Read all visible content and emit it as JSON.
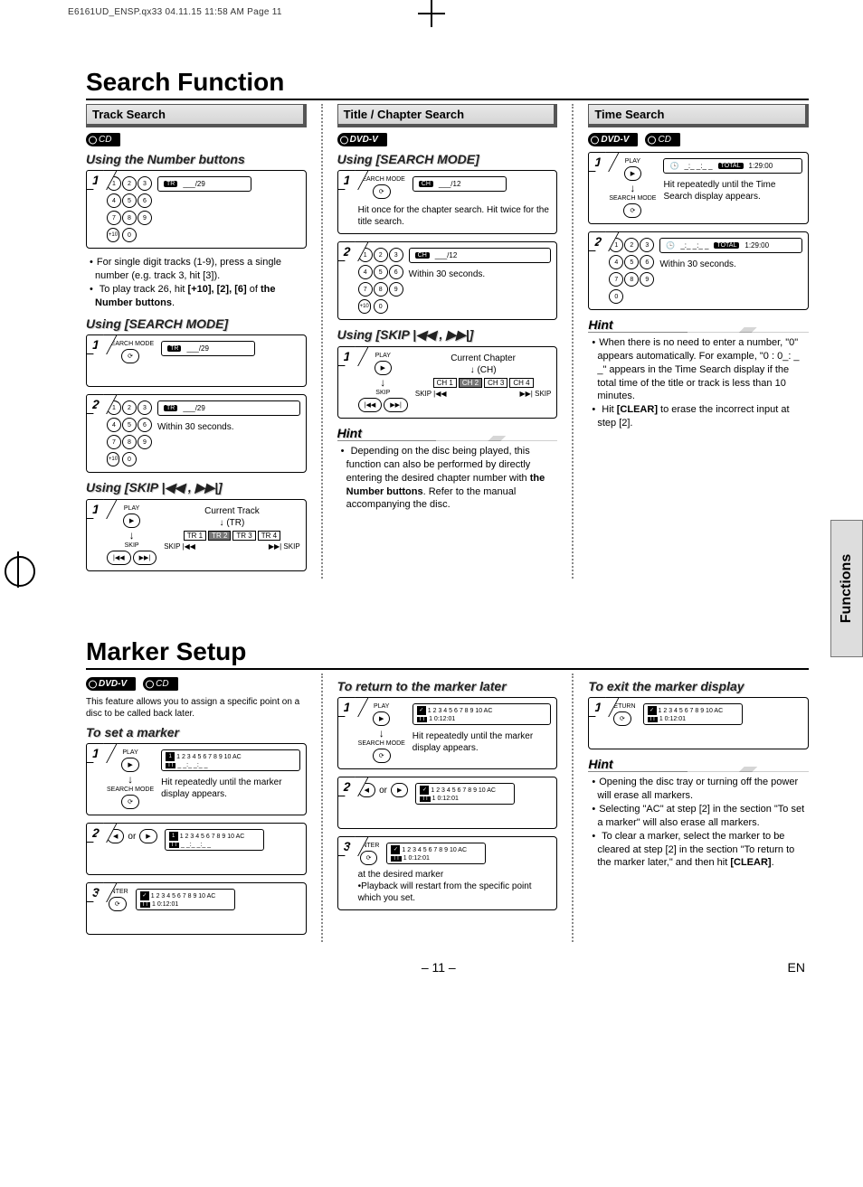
{
  "slug": "E6161UD_ENSP.qx33  04.11.15 11:58 AM  Page 11",
  "footer": {
    "page": "– 11 –",
    "lang": "EN"
  },
  "side_tab": "Functions",
  "section1": {
    "title": "Search Function",
    "col1": {
      "head": "Track Search",
      "badge_cd": "CD",
      "sub1": "Using the Number buttons",
      "display_tr29": "___/29",
      "display_tag_tr": "TR",
      "bul1": "For single digit tracks (1-9), press a single number (e.g. track 3, hit [3]).",
      "bul2_a": "To play track 26, hit ",
      "bul2_b": "[+10], [2], [6]",
      "bul2_c": " of ",
      "bul2_d": "the Number buttons",
      "bul2_e": ".",
      "sub2": "Using [SEARCH MODE]",
      "label_searchmode": "SEARCH MODE",
      "within30": "Within 30 seconds.",
      "sub3": "Using [SKIP |◀◀ , ▶▶|]",
      "label_play": "PLAY",
      "label_skip": "SKIP",
      "cur_track_label": "Current Track",
      "cur_track_abbr": "(TR)",
      "tracks": [
        "TR 1",
        "TR 2",
        "TR 3",
        "TR 4"
      ],
      "skip_prev": "SKIP |◀◀",
      "skip_next": "▶▶| SKIP"
    },
    "col2": {
      "head": "Title / Chapter Search",
      "badge_dvd": "DVD-V",
      "sub1": "Using [SEARCH MODE]",
      "display_tag_ch": "CH",
      "display_ch12": "___/12",
      "step1_note": "Hit once for the chapter search. Hit twice for the title search.",
      "within30": "Within 30 seconds.",
      "sub2": "Using [SKIP |◀◀ , ▶▶|]",
      "label_play": "PLAY",
      "label_skip": "SKIP",
      "cur_ch_label": "Current Chapter",
      "cur_ch_abbr": "(CH)",
      "chapters": [
        "CH 1",
        "CH 2",
        "CH 3",
        "CH 4"
      ],
      "skip_prev": "SKIP |◀◀",
      "skip_next": "▶▶| SKIP",
      "hint_head": "Hint",
      "hint_a": "Depending on the disc being played, this function can also be performed by directly entering the desired chapter number with ",
      "hint_b": "the Number buttons",
      "hint_c": ". Refer to the manual accompanying the disc."
    },
    "col3": {
      "head": "Time Search",
      "badge_dvd": "DVD-V",
      "badge_cd": "CD",
      "label_play": "PLAY",
      "label_searchmode": "SEARCH MODE",
      "total_label": "TOTAL",
      "total_time": "1:29:00",
      "time_blank": "_:_ _:_ _",
      "step1_note": "Hit repeatedly until the Time Search display appears.",
      "within30": "Within 30 seconds.",
      "hint_head": "Hint",
      "hint1": "When there is no need to enter a number, \"0\" appears automatically. For example, \"0 : 0_: _ _\" appears in the Time Search display if the total time of the title or track is less than 10 minutes.",
      "hint2_a": "Hit ",
      "hint2_b": "[CLEAR]",
      "hint2_c": " to erase the incorrect input at step [2]."
    }
  },
  "section2": {
    "title": "Marker Setup",
    "intro_badges": {
      "dvd": "DVD-V",
      "cd": "CD"
    },
    "intro_text": "This feature allows you to assign a specific point on a disc to be called back later.",
    "colA": {
      "sub": "To set a marker",
      "label_play": "PLAY",
      "label_searchmode": "SEARCH MODE",
      "step1_note": "Hit repeatedly until the marker display appears.",
      "or": "or",
      "label_enter": "ENTER",
      "marker_slots": "1 2 3 4 5 6 7 8 9 10 AC",
      "marker_tt": "TT",
      "marker_blank": "_ _:_ _:_ _",
      "marker_time": "1  0:12:01",
      "check": "✓"
    },
    "colB": {
      "sub": "To return to the marker later",
      "label_play": "PLAY",
      "label_searchmode": "SEARCH MODE",
      "step1_note": "Hit repeatedly until the marker display appears.",
      "or": "or",
      "label_enter": "ENTER",
      "step3_note": "at the desired marker",
      "step3_sub": "•Playback will restart from the specific point which you set."
    },
    "colC": {
      "sub": "To exit the marker display",
      "label_return": "RETURN",
      "hint_head": "Hint",
      "hint1": "Opening the disc tray or turning off the power will erase all markers.",
      "hint2": "Selecting \"AC\" at step [2] in the section \"To set a marker\" will also erase all markers.",
      "hint3_a": "To clear a marker, select the marker to be cleared at step [2] in the section \"To return to the marker later,\" and then hit ",
      "hint3_b": "[CLEAR]",
      "hint3_c": "."
    }
  },
  "keypad": [
    "1",
    "2",
    "3",
    "4",
    "5",
    "6",
    "7",
    "8",
    "9",
    "0"
  ],
  "key_plus10": "+10"
}
